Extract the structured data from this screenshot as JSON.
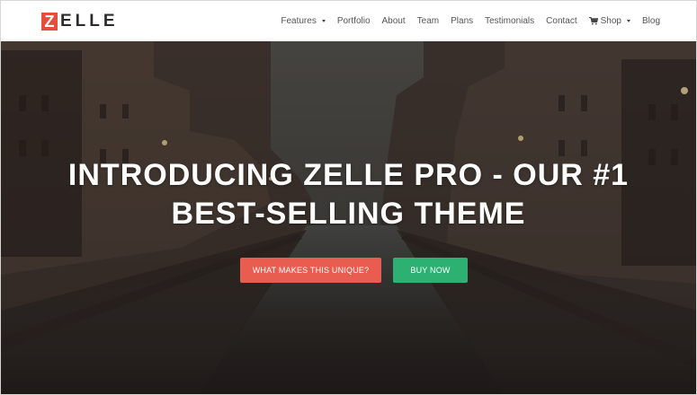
{
  "logo": {
    "letter": "Z",
    "rest": "ELLE"
  },
  "nav": {
    "items": [
      {
        "label": "Features",
        "dropdown": true
      },
      {
        "label": "Portfolio"
      },
      {
        "label": "About"
      },
      {
        "label": "Team"
      },
      {
        "label": "Plans"
      },
      {
        "label": "Testimonials"
      },
      {
        "label": "Contact"
      },
      {
        "label": "Shop",
        "dropdown": true,
        "icon": "cart-icon"
      },
      {
        "label": "Blog"
      }
    ]
  },
  "hero": {
    "title_line1": "INTRODUCING ZELLE PRO - OUR #1",
    "title_line2": "BEST-SELLING THEME",
    "button_primary": "WHAT MAKES THIS UNIQUE?",
    "button_secondary": "BUY NOW"
  },
  "colors": {
    "brand_red": "#e74c3c",
    "button_red": "#e85d4f",
    "button_green": "#2db173"
  }
}
